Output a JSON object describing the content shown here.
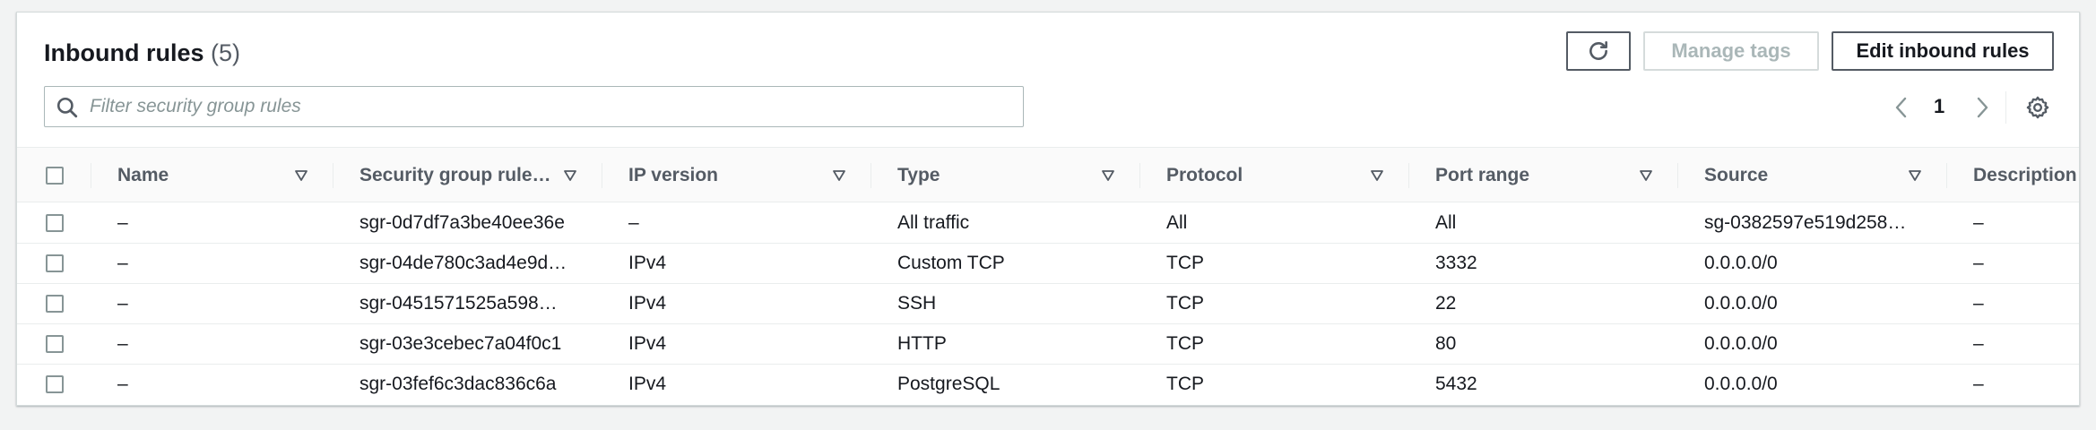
{
  "header": {
    "title": "Inbound rules",
    "count": "(5)"
  },
  "toolbar": {
    "refresh_icon": "refresh-icon",
    "manage_tags_label": "Manage tags",
    "edit_inbound_label": "Edit inbound rules"
  },
  "search": {
    "placeholder": "Filter security group rules",
    "value": ""
  },
  "pagination": {
    "current_page": "1"
  },
  "table": {
    "columns": [
      "Name",
      "Security group rule…",
      "IP version",
      "Type",
      "Protocol",
      "Port range",
      "Source",
      "Description"
    ],
    "rows": [
      {
        "name": "–",
        "rule_id": "sgr-0d7df7a3be40ee36e",
        "ip_version": "–",
        "type": "All traffic",
        "protocol": "All",
        "port_range": "All",
        "source": "sg-0382597e519d258…",
        "description": "–"
      },
      {
        "name": "–",
        "rule_id": "sgr-04de780c3ad4e9d…",
        "ip_version": "IPv4",
        "type": "Custom TCP",
        "protocol": "TCP",
        "port_range": "3332",
        "source": "0.0.0.0/0",
        "description": "–"
      },
      {
        "name": "–",
        "rule_id": "sgr-0451571525a598…",
        "ip_version": "IPv4",
        "type": "SSH",
        "protocol": "TCP",
        "port_range": "22",
        "source": "0.0.0.0/0",
        "description": "–"
      },
      {
        "name": "–",
        "rule_id": "sgr-03e3cebec7a04f0c1",
        "ip_version": "IPv4",
        "type": "HTTP",
        "protocol": "TCP",
        "port_range": "80",
        "source": "0.0.0.0/0",
        "description": "–"
      },
      {
        "name": "–",
        "rule_id": "sgr-03fef6c3dac836c6a",
        "ip_version": "IPv4",
        "type": "PostgreSQL",
        "protocol": "TCP",
        "port_range": "5432",
        "source": "0.0.0.0/0",
        "description": "–"
      }
    ]
  },
  "colors": {
    "text": "#16191f",
    "secondary_text": "#545b64",
    "border": "#eaeded",
    "disabled": "#aab7b8"
  }
}
